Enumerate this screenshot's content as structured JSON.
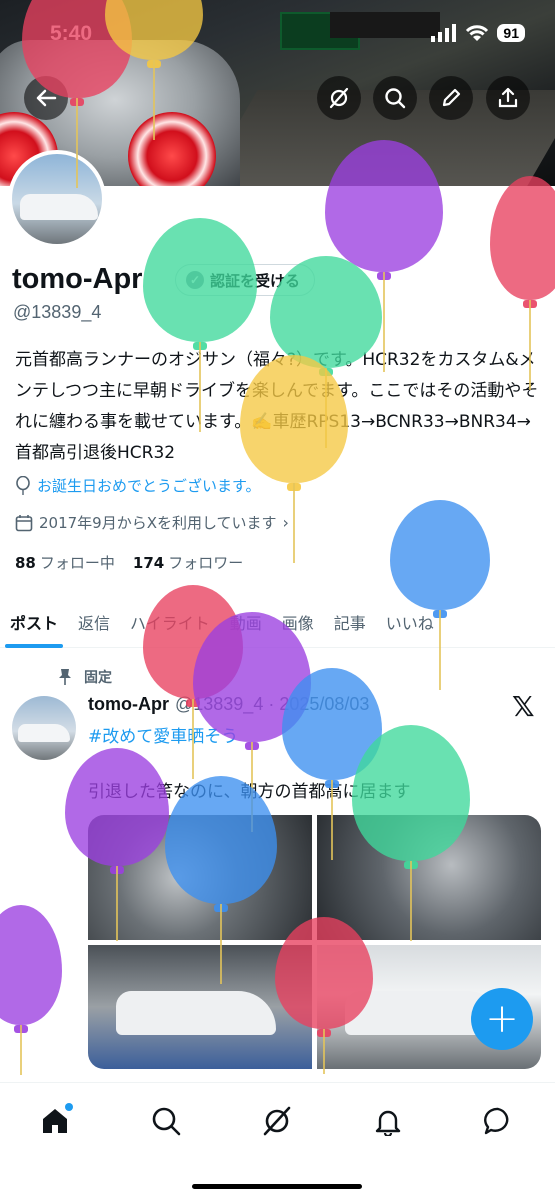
{
  "status_bar": {
    "time": "5:40",
    "battery": "91"
  },
  "header": {
    "back": "back",
    "icons": [
      "grok-icon",
      "search-icon",
      "edit-icon",
      "share-icon"
    ]
  },
  "profile": {
    "name": "tomo-Apr",
    "verify_label": "認証を受ける",
    "handle": "@13839_4",
    "bio": "元首都高ランナーのオジサン（福々?）です。HCR32をカスタム&メンテしつつ主に早朝ドライブを楽しんでます。ここではその活動やそれに纏わる事を載せています。✍️車歴RPS13→BCNR33→BNR34→首都高引退後HCR32",
    "birthday": "お誕生日おめでとうございます。",
    "joined": "2017年9月からXを利用しています",
    "following_count": "88",
    "following_label": "フォロー中",
    "followers_count": "174",
    "followers_label": "フォロワー"
  },
  "tabs": [
    "ポスト",
    "返信",
    "ハイライト",
    "動画",
    "画像",
    "記事",
    "いいね"
  ],
  "post": {
    "pinned_label": "固定",
    "author": "tomo-Apr",
    "handle_date": "@13839_4 · 2025/08/03",
    "hashtag": "#改めて愛車晒そう",
    "text": "引退した筈なのに、朝方の首都高に居ます"
  },
  "colors": {
    "accent": "#1d9bf0",
    "text": "#0f1419",
    "muted": "#536471"
  }
}
